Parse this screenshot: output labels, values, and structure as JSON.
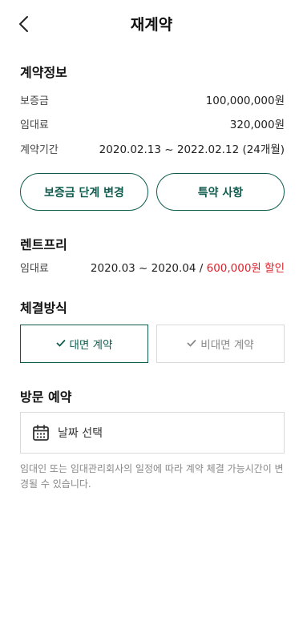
{
  "header": {
    "title": "재계약"
  },
  "contract_info": {
    "title": "계약정보",
    "rows": [
      {
        "label": "보증금",
        "value": "100,000,000원"
      },
      {
        "label": "임대료",
        "value": "320,000원"
      },
      {
        "label": "계약기간",
        "value": "2020.02.13 ~ 2022.02.12 (24개월)"
      }
    ],
    "buttons": {
      "change_deposit": "보증금 단계 변경",
      "special_terms": "특약 사항"
    }
  },
  "rent_free": {
    "title": "렌트프리",
    "label": "임대료",
    "period": "2020.03 ~ 2020.04 / ",
    "discount": "600,000원 할인"
  },
  "signing_method": {
    "title": "체결방식",
    "options": [
      {
        "label": "대면 계약",
        "selected": true
      },
      {
        "label": "비대면 계약",
        "selected": false
      }
    ]
  },
  "visit": {
    "title": "방문 예약",
    "date_placeholder": "날짜 선택",
    "notice": "임대인 또는 임대관리회사의 일정에 따라 계약 체결 가능시간이 변경될 수 있습니다."
  },
  "colors": {
    "accent": "#0f5c4e",
    "discount": "#e0202a",
    "muted": "#888888",
    "border": "#d9d9d9"
  },
  "icons": {
    "back": "chevron-left-icon",
    "check": "check-icon",
    "calendar": "calendar-icon"
  }
}
